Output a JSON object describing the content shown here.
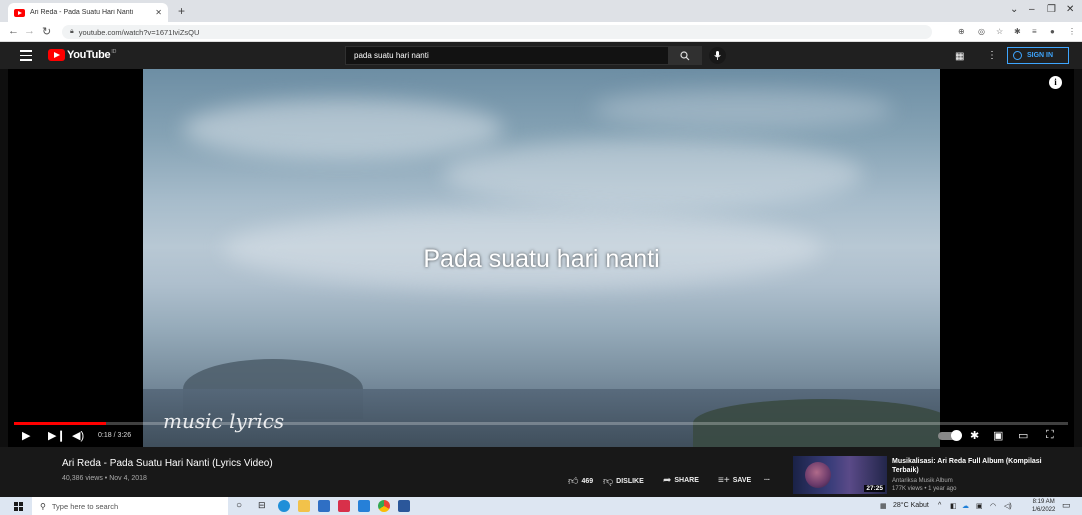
{
  "browser": {
    "tab_title": "Ari Reda - Pada Suatu Hari Nanti",
    "tab_close": "✕",
    "new_tab": "+",
    "window_controls": [
      "⌄",
      "–",
      "❐",
      "✕"
    ],
    "url": "youtube.com/watch?v=1671IviZsQU"
  },
  "youtube": {
    "logo_text": "YouTube",
    "logo_region": "ID",
    "search_query": "pada suatu hari nanti",
    "sign_in_label": "SIGN IN"
  },
  "player": {
    "lyric_text": "Pada suatu hari nanti",
    "watermark_text": "music lyrics",
    "time_display": "0:18 / 3:26",
    "progress_fraction": 0.087
  },
  "video": {
    "title": "Ari Reda - Pada Suatu Hari Nanti (Lyrics Video)",
    "meta": "40,386 views • Nov 4, 2018",
    "likes": "469",
    "dislike_label": "DISLIKE",
    "share_label": "SHARE",
    "save_label": "SAVE",
    "more_label": "..."
  },
  "up_next": {
    "title": "Musikalisasi: Ari Reda Full Album (Kompilasi Terbaik)",
    "channel": "Antariksa Musik Album",
    "views": "177K views • 1 year ago",
    "duration": "27:25"
  },
  "taskbar": {
    "search_placeholder": "Type here to search",
    "weather": "28°C  Kabut",
    "time": "8:19 AM",
    "date": "1/6/2022"
  }
}
